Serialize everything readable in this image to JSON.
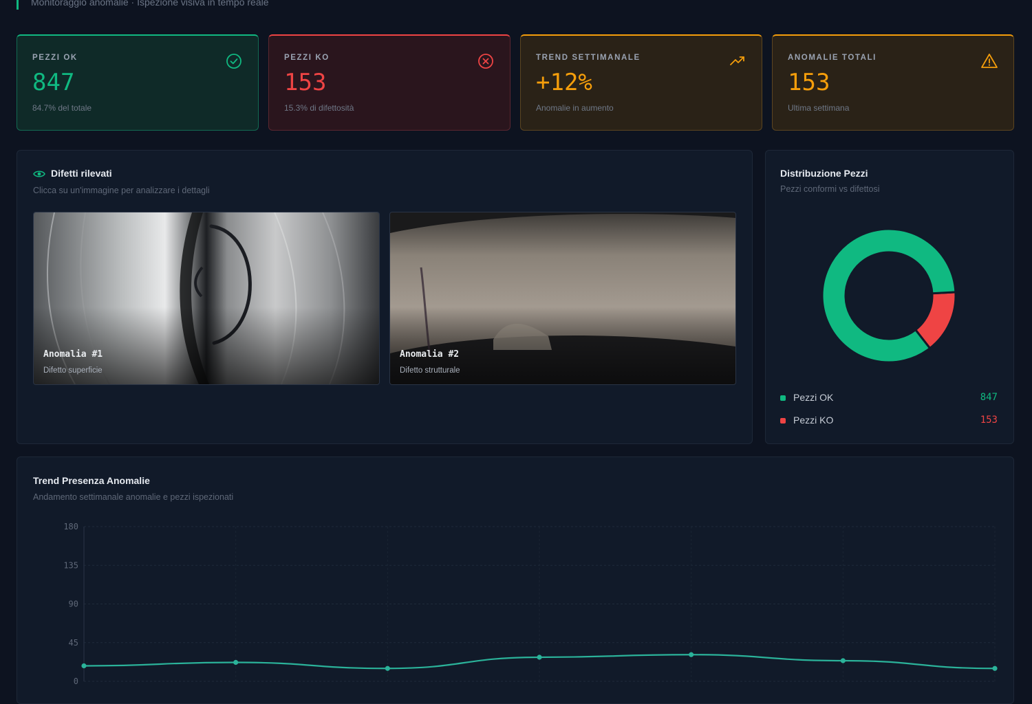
{
  "header": {
    "subtitle": "Monitoraggio anomalie · Ispezione visiva in tempo reale"
  },
  "kpis": [
    {
      "label": "PEZZI OK",
      "value": "847",
      "sub": "84.7% del totale",
      "color": "#10b981",
      "icon": "check-circle-icon"
    },
    {
      "label": "PEZZI KO",
      "value": "153",
      "sub": "15.3% di difettosità",
      "color": "#ef4444",
      "icon": "x-circle-icon"
    },
    {
      "label": "TREND SETTIMANALE",
      "value": "+12%",
      "sub": "Anomalie in aumento",
      "color": "#f59e0b",
      "icon": "trending-up-icon"
    },
    {
      "label": "ANOMALIE TOTALI",
      "value": "153",
      "sub": "Ultima settimana",
      "color": "#f59e0b",
      "icon": "warning-triangle-icon"
    }
  ],
  "defects": {
    "title": "Difetti rilevati",
    "subtitle": "Clicca su un'immagine per analizzare i dettagli",
    "items": [
      {
        "title": "Anomalia #1",
        "subtitle": "Difetto superficie"
      },
      {
        "title": "Anomalia #2",
        "subtitle": "Difetto strutturale"
      }
    ]
  },
  "distribution": {
    "title": "Distribuzione Pezzi",
    "subtitle": "Pezzi conformi vs difettosi",
    "legend": [
      {
        "name": "Pezzi OK",
        "value": "847",
        "color": "#10b981"
      },
      {
        "name": "Pezzi KO",
        "value": "153",
        "color": "#ef4444"
      }
    ]
  },
  "trend": {
    "title": "Trend Presenza Anomalie",
    "subtitle": "Andamento settimanale anomalie e pezzi ispezionati"
  },
  "chart_data": [
    {
      "type": "pie",
      "categories": [
        "Pezzi OK",
        "Pezzi KO"
      ],
      "values": [
        847,
        153
      ],
      "colors": [
        "#10b981",
        "#ef4444"
      ],
      "donut": true
    },
    {
      "type": "line",
      "x": [
        1,
        2,
        3,
        4,
        5,
        6,
        7
      ],
      "y_ticks": [
        "180",
        "135",
        "90",
        "45",
        "0"
      ],
      "ylim": [
        0,
        180
      ],
      "series": [
        {
          "values": [
            18,
            22,
            15,
            28,
            31,
            24,
            15
          ],
          "color": "#2bb39a"
        }
      ],
      "grid": true
    }
  ]
}
